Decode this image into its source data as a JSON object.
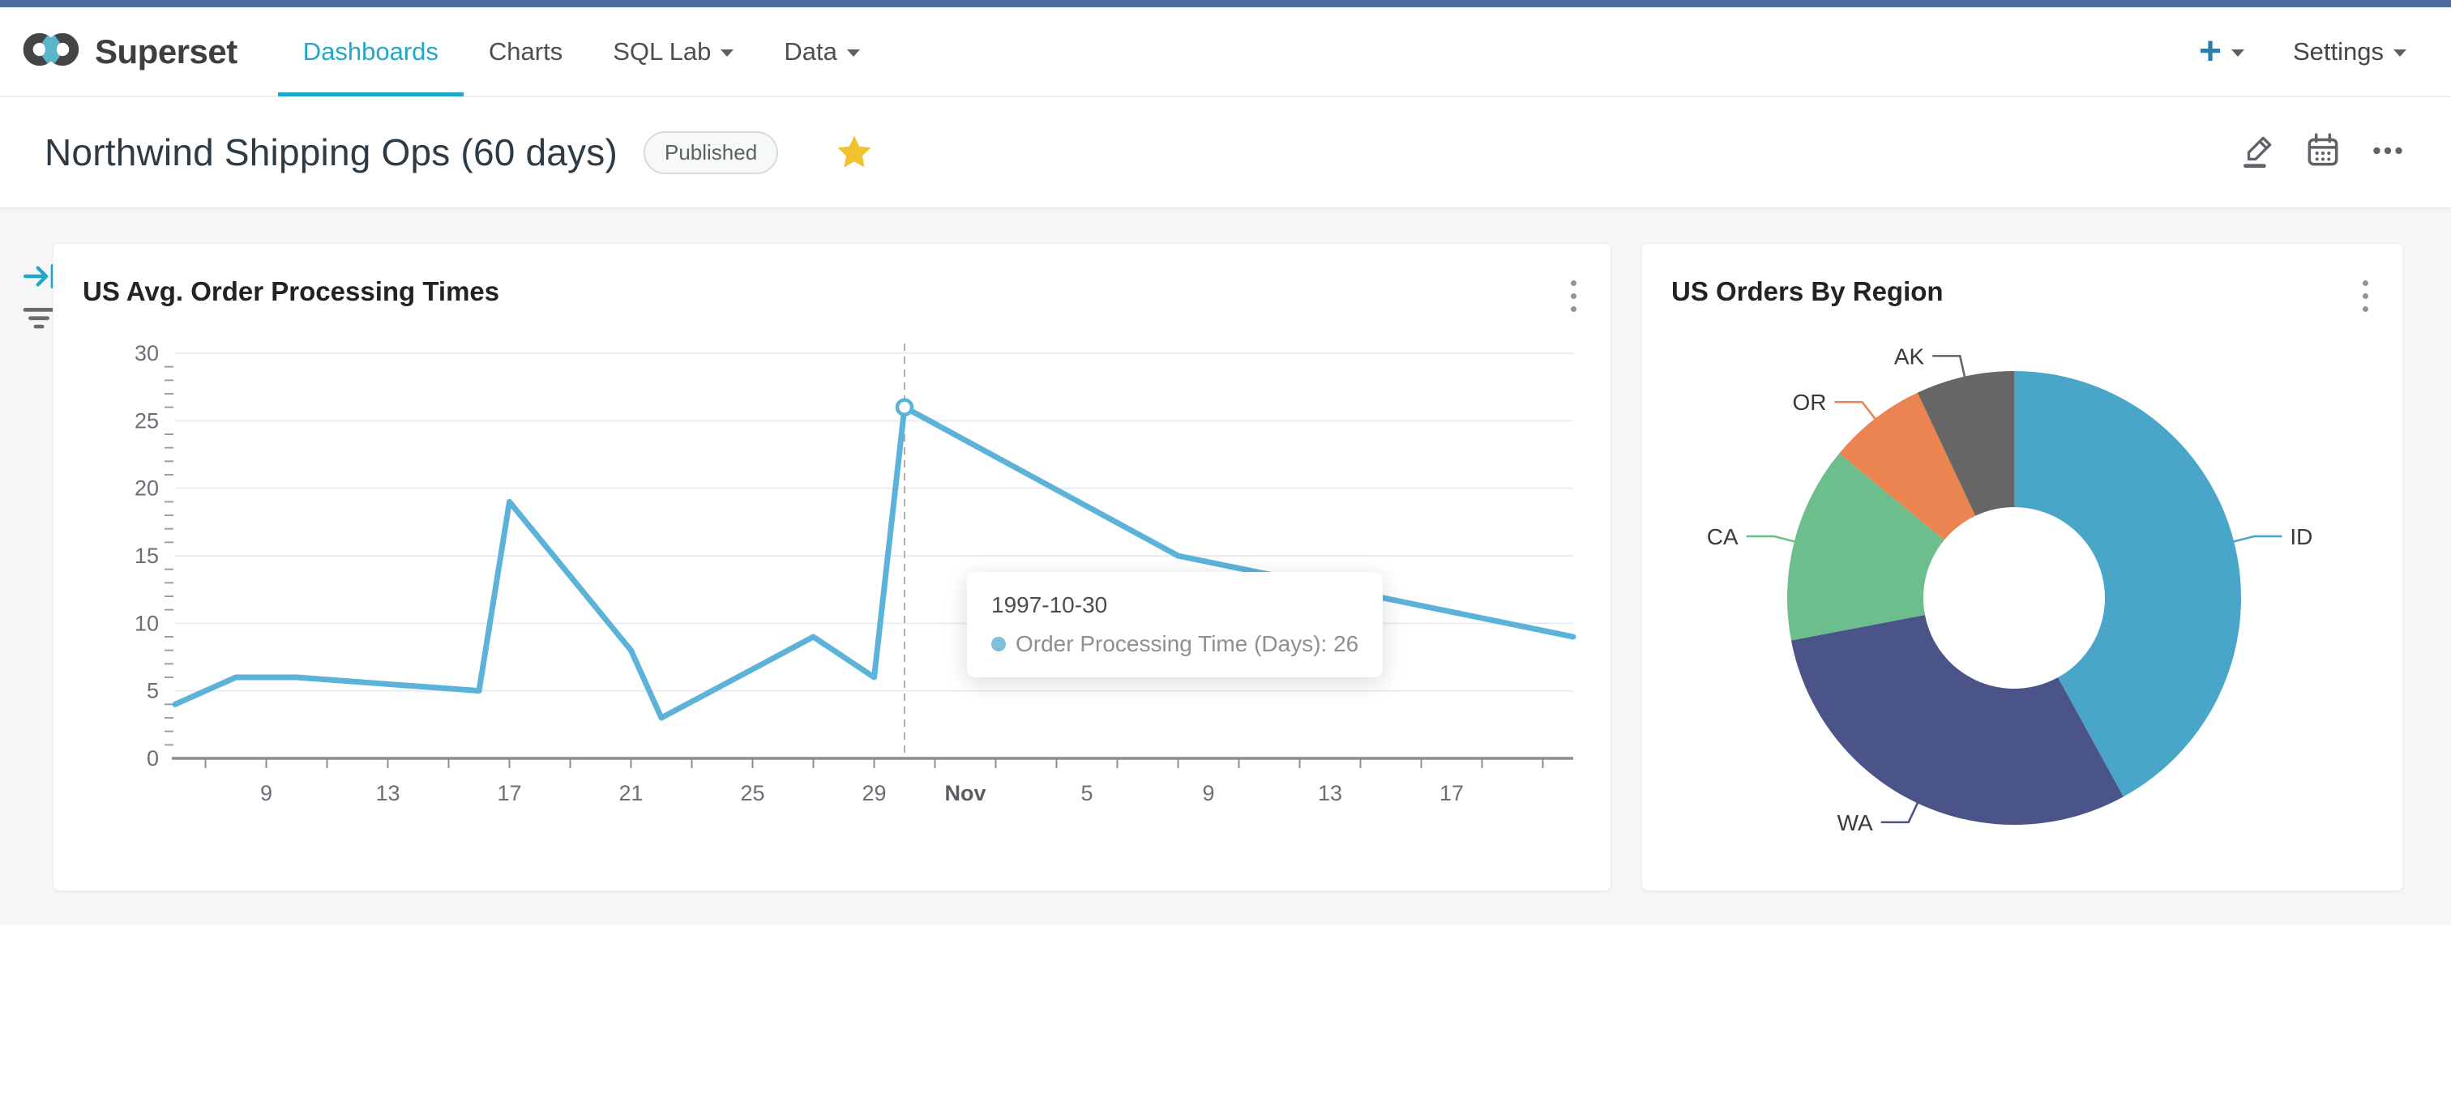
{
  "colors": {
    "accent": "#20A7C9",
    "top_bar": "#4C6B9F",
    "line_series": "#5CB3D9",
    "tooltip_marker": "#7CC0DC",
    "star": "#F2C12E",
    "page_background": "#F6F6F6"
  },
  "navbar": {
    "brand": "Superset",
    "items": [
      {
        "label": "Dashboards",
        "active": true
      },
      {
        "label": "Charts",
        "active": false
      },
      {
        "label": "SQL Lab",
        "active": false,
        "caret": true
      },
      {
        "label": "Data",
        "active": false,
        "caret": true
      }
    ],
    "plus_icon": "+",
    "settings_label": "Settings"
  },
  "header": {
    "title": "Northwind Shipping Ops (60 days)",
    "badge": "Published"
  },
  "icons": {
    "favorite": "star",
    "edit": "pencil",
    "schedule": "calendar",
    "more": "ellipsis",
    "expand_filter_bar": "arrow-to-bar",
    "filter": "filter-lines",
    "chart_menu": "kebab-vertical"
  },
  "chart_data": [
    {
      "type": "line",
      "title": "US Avg. Order Processing Times",
      "xlabel": "",
      "ylabel": "",
      "ylim": [
        0,
        30
      ],
      "yticks": [
        0,
        5,
        10,
        15,
        20,
        25,
        30
      ],
      "grid": "horizontal",
      "legend": "none",
      "xlim": [
        "1997-10-06",
        "1997-11-21"
      ],
      "xticks": [
        {
          "label": "9",
          "date": "1997-10-09"
        },
        {
          "label": "13",
          "date": "1997-10-13"
        },
        {
          "label": "17",
          "date": "1997-10-17"
        },
        {
          "label": "21",
          "date": "1997-10-21"
        },
        {
          "label": "25",
          "date": "1997-10-25"
        },
        {
          "label": "29",
          "date": "1997-10-29"
        },
        {
          "label": "Nov",
          "date": "1997-11-01",
          "bold": true
        },
        {
          "label": "5",
          "date": "1997-11-05"
        },
        {
          "label": "9",
          "date": "1997-11-09"
        },
        {
          "label": "13",
          "date": "1997-11-13"
        },
        {
          "label": "17",
          "date": "1997-11-17"
        }
      ],
      "series": [
        {
          "name": "Order Processing Time (Days)",
          "color": "#5CB3D9",
          "points": [
            [
              "1997-10-06",
              4
            ],
            [
              "1997-10-08",
              6
            ],
            [
              "1997-10-10",
              6
            ],
            [
              "1997-10-16",
              5
            ],
            [
              "1997-10-17",
              19
            ],
            [
              "1997-10-21",
              8
            ],
            [
              "1997-10-22",
              3
            ],
            [
              "1997-10-27",
              9
            ],
            [
              "1997-10-29",
              6
            ],
            [
              "1997-10-30",
              26
            ],
            [
              "1997-11-08",
              15
            ],
            [
              "1997-11-21",
              9
            ]
          ]
        }
      ],
      "hover": {
        "date": "1997-10-30",
        "value": 26,
        "tooltip_title": "1997-10-30",
        "tooltip_label": "Order Processing Time (Days): 26"
      }
    },
    {
      "type": "pie",
      "title": "US Orders By Region",
      "donut": true,
      "inner_radius_ratio": 0.4,
      "labels_position": "outside-with-leader-lines",
      "legend": "none",
      "slices": [
        {
          "label": "ID",
          "value": 42,
          "color": "#4AA6C9"
        },
        {
          "label": "WA",
          "value": 30,
          "color": "#4A5489"
        },
        {
          "label": "CA",
          "value": 14,
          "color": "#6CBE8C"
        },
        {
          "label": "OR",
          "value": 7,
          "color": "#EC8452"
        },
        {
          "label": "AK",
          "value": 7,
          "color": "#666666"
        }
      ]
    }
  ]
}
